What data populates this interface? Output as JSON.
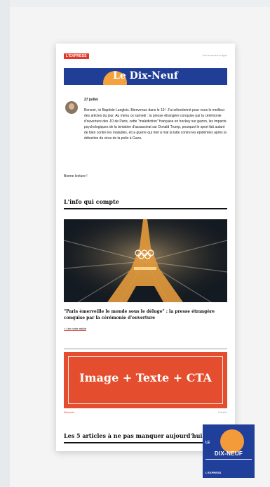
{
  "header": {
    "brand_logo": "L'EXPRESS",
    "view_online": "Voir la version en ligne"
  },
  "banner": {
    "title": "Le Dix-Neuf"
  },
  "intro": {
    "date": "27 juillet",
    "greeting": "Bonsoir, ici Baptiste Langlois. Bienvenue dans le 19 ! J'ai sélectionné pour vous le meilleur des articles du jour. Au menu ce samedi : la presse étrangère conquise par la cérémonie d'ouverture des JO de Paris, cette \"malédiction\" française en hockey sur gazon, les impacts psychologiques de la tentative d'assassinat sur Donald Trump, pourquoi le sport fait autant de bien contre les maladies, et la guerre qui met à mal la lutte contre les épidémies après la détection du virus de la polio à Gaza.",
    "closing": "Bonne lecture !"
  },
  "section_info": {
    "title": "L'info qui compte"
  },
  "top_article": {
    "title": "\"Paris émerveille le monde sous le déluge\" : la presse étrangère conquise par la cérémonie d'ouverture",
    "read_link": "> Lire notre article"
  },
  "promo": {
    "text": "Image + Texte + CTA",
    "left_label": "Découvrir",
    "right_label": "Publicité"
  },
  "section_articles": {
    "title": "Les 5 articles à ne pas manquer aujourd'hui"
  },
  "badge": {
    "prefix": "LE",
    "name": "DIX-NEUF",
    "brand": "L'EXPRESS"
  },
  "colors": {
    "brand_red": "#e0382b",
    "banner_blue": "#213e97",
    "sun_orange": "#f3a23d",
    "promo_orange": "#e44e2e"
  }
}
